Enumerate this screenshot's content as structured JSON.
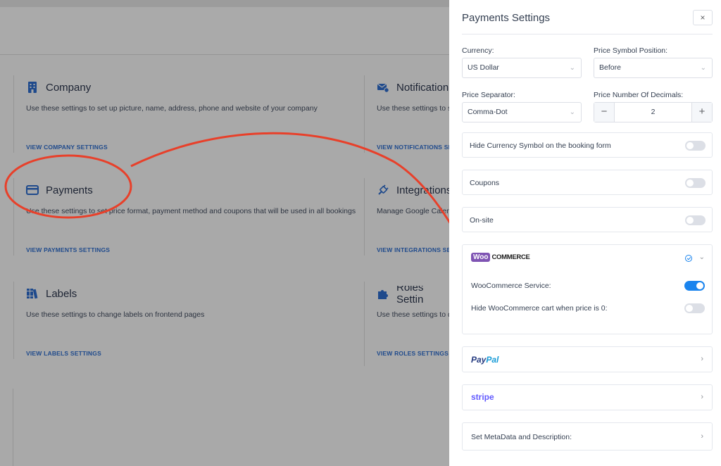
{
  "background": {
    "cards": [
      {
        "key": "company",
        "title": "Company",
        "desc": "Use these settings to set up picture, name, address, phone and website of your company",
        "link": "VIEW COMPANY SETTINGS",
        "icon": "building-icon"
      },
      {
        "key": "notifications",
        "title": "Notification",
        "desc": "Use these settings to s",
        "link": "VIEW NOTIFICATIONS SET",
        "icon": "mail-gear-icon"
      },
      {
        "key": "payments",
        "title": "Payments",
        "desc": "Use these settings to set price format, payment method and coupons that will be used in all bookings",
        "link": "VIEW PAYMENTS SETTINGS",
        "icon": "credit-card-icon"
      },
      {
        "key": "integrations",
        "title": "Integrations",
        "desc": "Manage Google Calend",
        "link": "VIEW INTEGRATIONS SET",
        "icon": "plug-icon"
      },
      {
        "key": "labels",
        "title": "Labels",
        "desc": "Use these settings to change labels on frontend pages",
        "link": "VIEW LABELS SETTINGS",
        "icon": "books-icon"
      },
      {
        "key": "roles",
        "title": "Roles Settin",
        "desc": "Use these settings to d",
        "link": "VIEW ROLES SETTINGS",
        "icon": "puzzle-icon"
      }
    ]
  },
  "panel": {
    "title": "Payments Settings",
    "close_label": "×",
    "currency": {
      "label": "Currency:",
      "value": "US Dollar"
    },
    "price_symbol_position": {
      "label": "Price Symbol Position:",
      "value": "Before"
    },
    "price_separator": {
      "label": "Price Separator:",
      "value": "Comma-Dot"
    },
    "decimals": {
      "label": "Price Number Of Decimals:",
      "value": "2",
      "minus": "−",
      "plus": "+"
    },
    "hide_currency": {
      "label": "Hide Currency Symbol on the booking form",
      "on": false
    },
    "coupons": {
      "label": "Coupons",
      "on": false
    },
    "onsite": {
      "label": "On-site",
      "on": false
    },
    "woocommerce": {
      "badge": "Woo",
      "logo_text": "COMMERCE",
      "service_label": "WooCommerce Service:",
      "service_on": true,
      "hide_cart_label": "Hide WooCommerce cart when price is 0:",
      "hide_cart_on": false
    },
    "paypal": {
      "part1": "Pay",
      "part2": "Pal"
    },
    "stripe": {
      "label": "stripe"
    },
    "metadata": {
      "label": "Set MetaData and Description:"
    }
  },
  "colors": {
    "accent": "#1a84ee",
    "annotation": "#e8402a",
    "woo_purple": "#7f54b3",
    "link": "#1f4a8c"
  }
}
